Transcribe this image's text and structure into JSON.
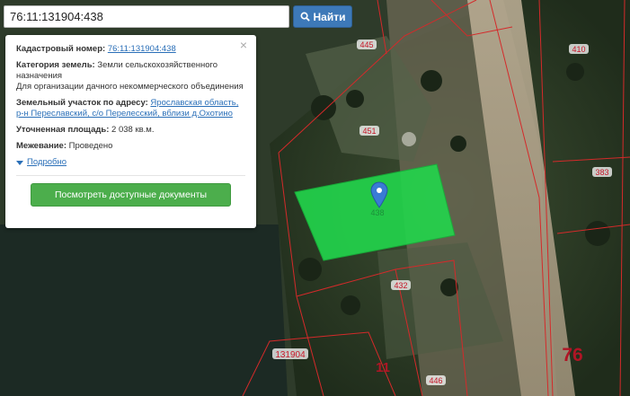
{
  "search": {
    "value": "76:11:131904:438",
    "button_label": "Найти"
  },
  "panel": {
    "close_glyph": "×",
    "cadastral_label": "Кадастровый номер:",
    "cadastral_value": "76:11:131904:438",
    "category_label": "Категория земель:",
    "category_value": "Земли сельскохозяйственного назначения",
    "purpose_value": "Для организации дачного некоммерческого объединения",
    "address_label": "Земельный участок по адресу:",
    "address_value": "Ярославская область, р-н Переславский, с/о Перелесский, вблизи д.Охотино",
    "area_label": "Уточненная площадь:",
    "area_value": "2 038 кв.м.",
    "survey_label": "Межевание:",
    "survey_value": "Проведено",
    "more_label": "Подробно",
    "docs_button": "Посмотреть доступные документы"
  },
  "map_labels": {
    "p445": "445",
    "p410": "410",
    "p451": "451",
    "p383": "383",
    "p438": "438",
    "p432": "432",
    "block": "131904",
    "quarter11": "11",
    "region76": "76",
    "p446": "446"
  },
  "colors": {
    "parcel_fill": "#22d64c",
    "boundary": "#d42a2a",
    "button_blue": "#3d79b8",
    "button_green": "#4cae4c",
    "marker": "#3a7bd5"
  }
}
